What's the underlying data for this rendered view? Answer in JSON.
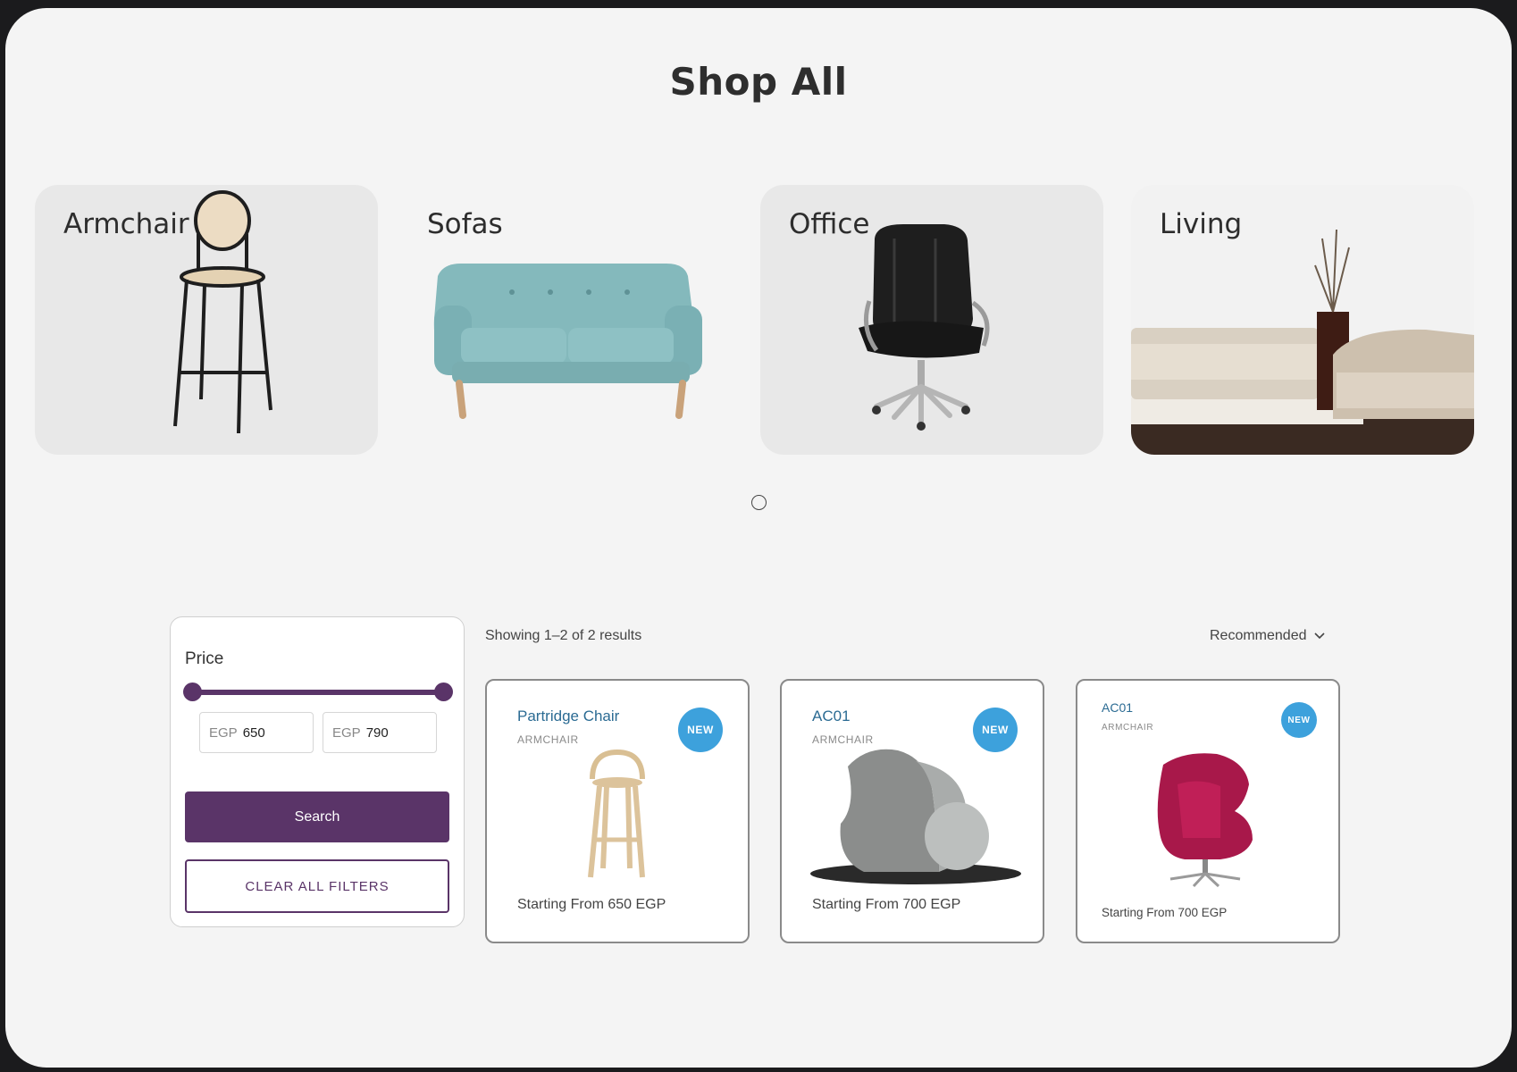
{
  "page": {
    "title": "Shop All"
  },
  "categories": [
    {
      "label": "Armchair"
    },
    {
      "label": "Sofas"
    },
    {
      "label": "Office"
    },
    {
      "label": "Living"
    }
  ],
  "filters": {
    "price_label": "Price",
    "currency": "EGP",
    "min": "650",
    "max": "790",
    "search_label": "Search",
    "clear_label": "CLEAR ALL FILTERS",
    "colors": {
      "accent": "#5a3468"
    }
  },
  "results": {
    "summary": "Showing 1–2 of 2 results",
    "sort_label": "Recommended"
  },
  "products": [
    {
      "name": "Partridge Chair",
      "category": "ARMCHAIR",
      "badge": "NEW",
      "price": "Starting From 650 EGP"
    },
    {
      "name": "AC01",
      "category": "ARMCHAIR",
      "badge": "NEW",
      "price": "Starting From 700 EGP"
    },
    {
      "name": "AC01",
      "category": "ARMCHAIR",
      "badge": "NEW",
      "price": "Starting From 700 EGP"
    }
  ],
  "icons": {
    "sort": "chevron-down-icon",
    "carousel": "carousel-dot-icon"
  }
}
